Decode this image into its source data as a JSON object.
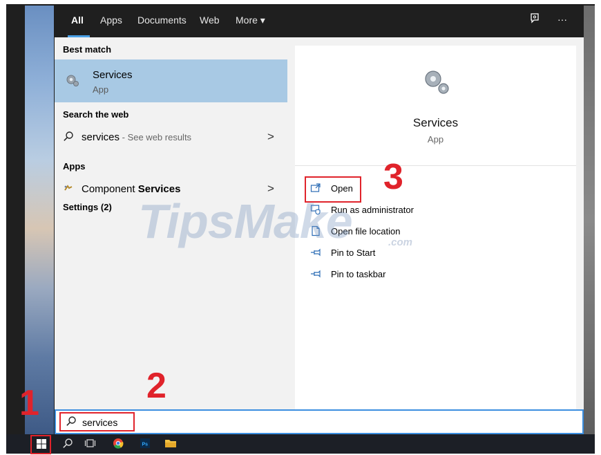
{
  "nav": {
    "tabs": [
      "All",
      "Apps",
      "Documents",
      "Web",
      "More"
    ],
    "more_arrow": "▾",
    "feedback_icon": "feedback-icon",
    "menu_dots": "···"
  },
  "left": {
    "best_match_header": "Best match",
    "best_match": {
      "title": "Services",
      "subtitle": "App"
    },
    "search_web_header": "Search the web",
    "web_result": {
      "query": "services",
      "suffix": " - See web results"
    },
    "apps_header": "Apps",
    "app_result": {
      "prefix": "Component ",
      "bold": "Services"
    },
    "settings_header": "Settings (2)",
    "chevron": ">"
  },
  "right": {
    "title": "Services",
    "subtitle": "App",
    "actions": [
      "Open",
      "Run as administrator",
      "Open file location",
      "Pin to Start",
      "Pin to taskbar"
    ]
  },
  "search": {
    "value": "services"
  },
  "annotations": {
    "step1": "1",
    "step2": "2",
    "step3": "3"
  },
  "watermark": {
    "main": "TipsMake",
    "suffix": ".com"
  },
  "colors": {
    "accent": "#3b8ee0",
    "highlight": "#a8c9e4",
    "callout": "#e0232b",
    "taskbar": "#1c1f26"
  }
}
